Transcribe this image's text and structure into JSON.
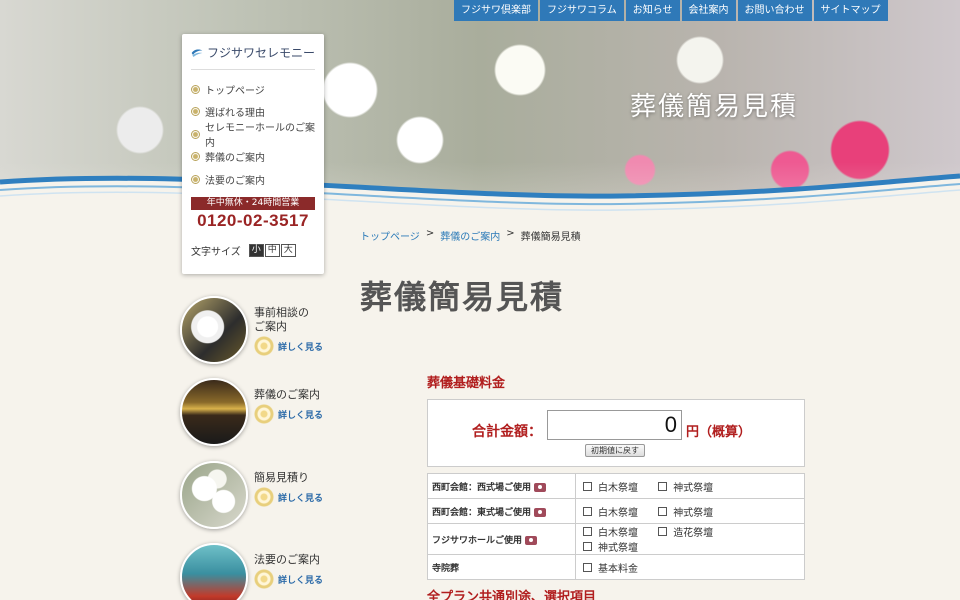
{
  "hero": {
    "title": "葬儀簡易見積"
  },
  "topnav": [
    {
      "label": "フジサワ倶楽部"
    },
    {
      "label": "フジサワコラム"
    },
    {
      "label": "お知らせ"
    },
    {
      "label": "会社案内"
    },
    {
      "label": "お問い合わせ"
    },
    {
      "label": "サイトマップ"
    }
  ],
  "sidebar": {
    "logo_text": "フジサワセレモニー",
    "menu": [
      {
        "label": "トップページ"
      },
      {
        "label": "選ばれる理由"
      },
      {
        "label": "セレモニーホールのご案内"
      },
      {
        "label": "葬儀のご案内"
      },
      {
        "label": "法要のご案内"
      }
    ],
    "hours": "年中無休・24時間営業",
    "phone": "0120-02-3517",
    "font_size_label": "文字サイズ",
    "font_sizes": [
      "小",
      "中",
      "大"
    ]
  },
  "promos": [
    {
      "title_line1": "事前相談の",
      "title_line2": "ご案内",
      "more": "詳しく見る"
    },
    {
      "title_line1": "葬儀のご案内",
      "title_line2": "",
      "more": "詳しく見る"
    },
    {
      "title_line1": "簡易見積り",
      "title_line2": "",
      "more": "詳しく見る"
    },
    {
      "title_line1": "法要のご案内",
      "title_line2": "",
      "more": "詳しく見る"
    }
  ],
  "breadcrumb": {
    "home": "トップページ",
    "sep": ">",
    "funeral": "葬儀のご案内",
    "current": "葬儀簡易見積"
  },
  "main": {
    "title": "葬儀簡易見積",
    "section_title": "葬儀基礎料金",
    "total_label": "合計金額：",
    "total_value": "0",
    "total_unit": "円（概算）",
    "reset_label": "初期値に戻す",
    "rows": [
      {
        "head": "西町会館：西式場ご使用",
        "camera": true,
        "options": [
          "白木祭壇",
          "神式祭壇"
        ]
      },
      {
        "head": "西町会館：東式場ご使用",
        "camera": true,
        "options": [
          "白木祭壇",
          "神式祭壇"
        ]
      },
      {
        "head": "フジサワホールご使用",
        "camera": true,
        "options": [
          "白木祭壇",
          "造花祭壇",
          "神式祭壇"
        ]
      },
      {
        "head": "寺院葬",
        "camera": false,
        "options": [
          "基本料金"
        ]
      }
    ],
    "next_section_title": "全プラン共通別途、選択項目"
  },
  "colors": {
    "nav_blue": "#2f79b8",
    "accent_red": "#b11e1e",
    "link_blue": "#2b7ab8"
  }
}
